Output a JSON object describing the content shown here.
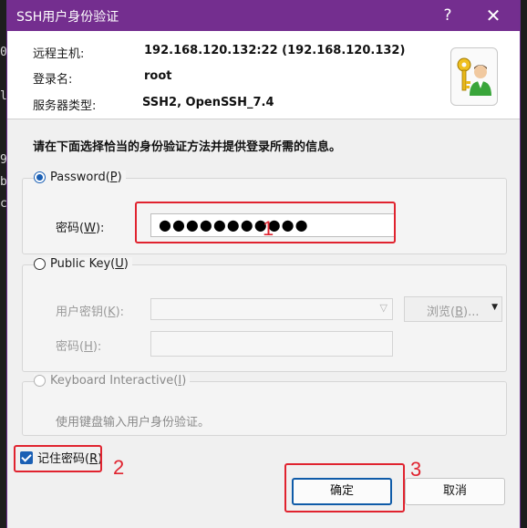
{
  "background": {
    "terminal_chars": [
      "0",
      "l",
      "9",
      "b",
      "c"
    ]
  },
  "dialog": {
    "title": "SSH用户身份验证",
    "help_symbol": "?",
    "close_symbol": "✕",
    "accent_color": "#742e8f"
  },
  "info": {
    "host_label": "远程主机:",
    "host_value": "192.168.120.132:22 (192.168.120.132)",
    "login_label": "登录名:",
    "login_value": "root",
    "server_label": "服务器类型:",
    "server_value": "SSH2, OpenSSH_7.4",
    "icon": "keys-user-icon"
  },
  "instruction": "请在下面选择恰当的身份验证方法并提供登录所需的信息。",
  "password_method": {
    "label_pre": "Password(",
    "label_key": "P",
    "label_post": ")",
    "selected": true,
    "field_label_pre": "密码(",
    "field_label_key": "W",
    "field_label_post": "):",
    "value": "●●●●●●●●●●●"
  },
  "pubkey_method": {
    "label_pre": "Public Key(",
    "label_key": "U",
    "label_post": ")",
    "selected": false,
    "key_label_pre": "用户密钥(",
    "key_label_key": "K",
    "key_label_post": "):",
    "browse_pre": "浏览(",
    "browse_key": "B",
    "browse_post": ")...",
    "pass_label_pre": "密码(",
    "pass_label_key": "H",
    "pass_label_post": "):"
  },
  "keyboard_method": {
    "label_pre": "Keyboard Interactive(",
    "label_key": "I",
    "label_post": ")",
    "selected": false,
    "description": "使用键盘输入用户身份验证。"
  },
  "remember": {
    "label_pre": "记住密码(",
    "label_key": "R",
    "label_post": ")",
    "checked": true
  },
  "buttons": {
    "ok": "确定",
    "cancel": "取消"
  },
  "annotations": [
    "1",
    "2",
    "3"
  ]
}
